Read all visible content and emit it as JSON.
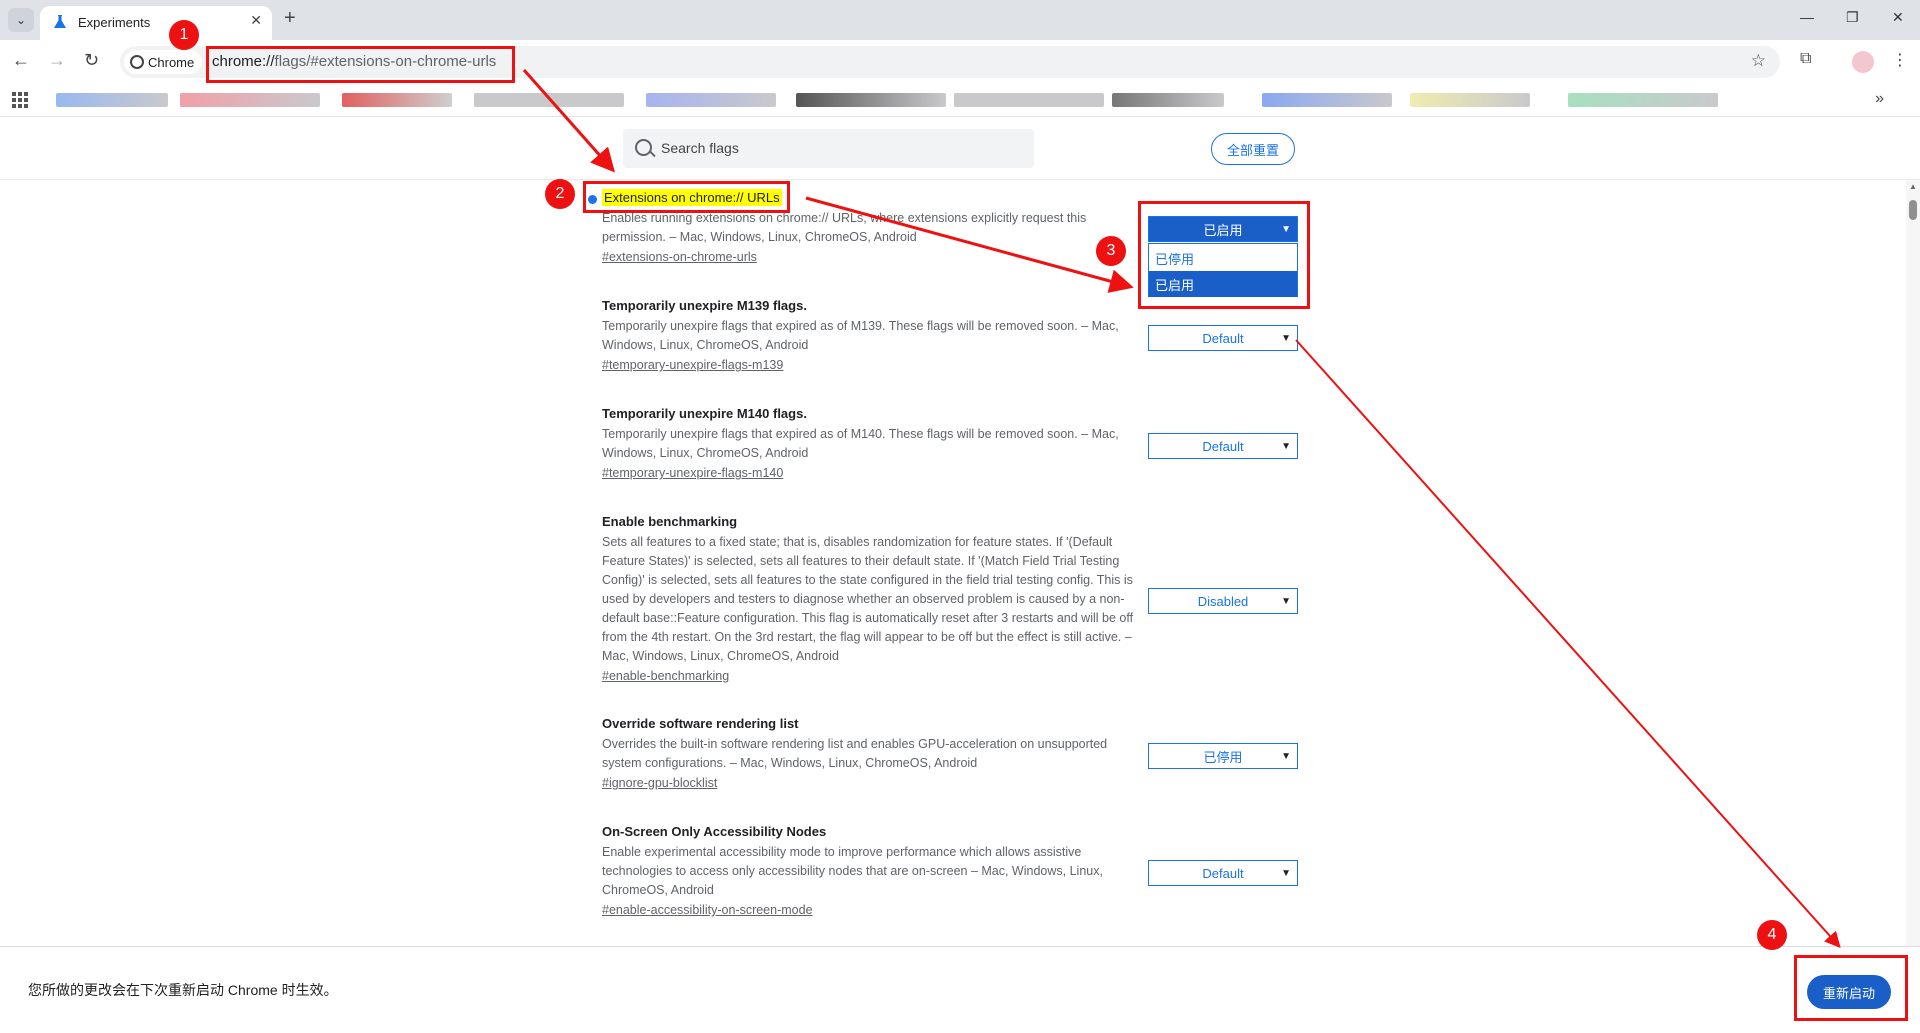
{
  "browser": {
    "tab_title": "Experiments",
    "tab_close": "✕",
    "new_tab": "+",
    "chip_label": "Chrome",
    "url_host": "chrome://",
    "url_path": "flags/#extensions-on-chrome-urls",
    "window": {
      "minimize": "—",
      "restore": "❐",
      "close": "✕"
    },
    "nav": {
      "back": "←",
      "forward": "→",
      "reload": "↻"
    },
    "star": "☆",
    "extensions": "⧉",
    "menu": "⋮",
    "bookmarks_more": "»",
    "tab_search": "⌄"
  },
  "flags_page": {
    "search_placeholder": "Search flags",
    "reset_all": "全部重置",
    "flags": [
      {
        "title": "Extensions on chrome:// URLs",
        "desc": "Enables running extensions on chrome:// URLs, where extensions explicitly request this permission. – Mac, Windows, Linux, ChromeOS, Android",
        "link": "#extensions-on-chrome-urls",
        "value": "已启用"
      },
      {
        "title": "Temporarily unexpire M139 flags.",
        "desc": "Temporarily unexpire flags that expired as of M139. These flags will be removed soon. – Mac, Windows, Linux, ChromeOS, Android",
        "link": "#temporary-unexpire-flags-m139",
        "value": "Default"
      },
      {
        "title": "Temporarily unexpire M140 flags.",
        "desc": "Temporarily unexpire flags that expired as of M140. These flags will be removed soon. – Mac, Windows, Linux, ChromeOS, Android",
        "link": "#temporary-unexpire-flags-m140",
        "value": "Default"
      },
      {
        "title": "Enable benchmarking",
        "desc": "Sets all features to a fixed state; that is, disables randomization for feature states. If '(Default Feature States)' is selected, sets all features to their default state. If '(Match Field Trial Testing Config)' is selected, sets all features to the state configured in the field trial testing config. This is used by developers and testers to diagnose whether an observed problem is caused by a non-default base::Feature configuration. This flag is automatically reset after 3 restarts and will be off from the 4th restart. On the 3rd restart, the flag will appear to be off but the effect is still active. – Mac, Windows, Linux, ChromeOS, Android",
        "link": "#enable-benchmarking",
        "value": "Disabled"
      },
      {
        "title": "Override software rendering list",
        "desc": "Overrides the built-in software rendering list and enables GPU-acceleration on unsupported system configurations. – Mac, Windows, Linux, ChromeOS, Android",
        "link": "#ignore-gpu-blocklist",
        "value": "已停用"
      },
      {
        "title": "On-Screen Only Accessibility Nodes",
        "desc": "Enable experimental accessibility mode to improve performance which allows assistive technologies to access only accessibility nodes that are on-screen – Mac, Windows, Linux, ChromeOS, Android",
        "link": "#enable-accessibility-on-screen-mode",
        "value": "Default"
      }
    ],
    "dropdown_options": [
      "已停用",
      "已启用"
    ],
    "dropdown_selected": "已启用"
  },
  "bottom_bar": {
    "message": "您所做的更改会在下次重新启动 Chrome 时生效。",
    "restart_button": "重新启动"
  },
  "annotations": {
    "color": "#ee1111",
    "badges": [
      "1",
      "2",
      "3",
      "4"
    ]
  },
  "colors": {
    "accent": "#1a73e8",
    "selected_fill": "#1a5fc8",
    "highlight": "#ffff00"
  }
}
